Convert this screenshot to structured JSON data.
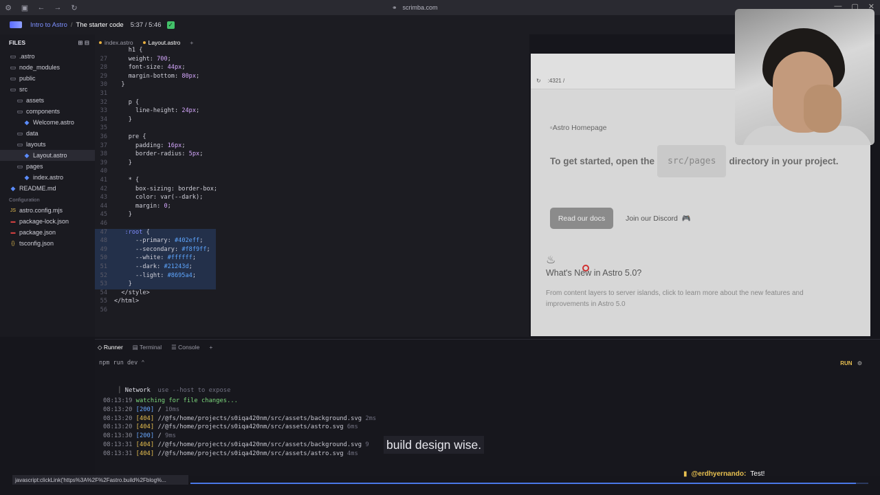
{
  "browser": {
    "url": "scrimba.com",
    "icons": [
      "app-icon",
      "sidebar-icon",
      "back-icon",
      "forward-icon",
      "reload-icon"
    ]
  },
  "header": {
    "course": "Intro to Astro",
    "separator": "/",
    "lesson": "The starter code",
    "time": "5:37 / 5:46",
    "check": "✓"
  },
  "sidebar": {
    "title": "FILES",
    "items": [
      {
        "label": ".astro",
        "type": "folder",
        "indent": 0
      },
      {
        "label": "node_modules",
        "type": "folder",
        "indent": 0
      },
      {
        "label": "public",
        "type": "folder",
        "indent": 0
      },
      {
        "label": "src",
        "type": "folder",
        "indent": 0
      },
      {
        "label": "assets",
        "type": "folder",
        "indent": 1
      },
      {
        "label": "components",
        "type": "folder",
        "indent": 1
      },
      {
        "label": "Welcome.astro",
        "type": "file",
        "indent": 2
      },
      {
        "label": "data",
        "type": "folder",
        "indent": 1
      },
      {
        "label": "layouts",
        "type": "folder",
        "indent": 1
      },
      {
        "label": "Layout.astro",
        "type": "file",
        "indent": 2,
        "active": true
      },
      {
        "label": "pages",
        "type": "folder",
        "indent": 1
      },
      {
        "label": "index.astro",
        "type": "file",
        "indent": 2
      },
      {
        "label": "README.md",
        "type": "file",
        "indent": 0
      }
    ],
    "config_label": "Configuration",
    "config_items": [
      {
        "label": "astro.config.mjs",
        "icon": "JS"
      },
      {
        "label": "package-lock.json",
        "icon": "pkg"
      },
      {
        "label": "package.json",
        "icon": "pkg"
      },
      {
        "label": "tsconfig.json",
        "icon": "{}"
      }
    ]
  },
  "editor": {
    "tabs": [
      {
        "label": "index.astro",
        "active": false
      },
      {
        "label": "Layout.astro",
        "active": true
      }
    ],
    "add_tab": "+",
    "lines": [
      {
        "n": "",
        "t": "    h1 {"
      },
      {
        "n": "27",
        "t": "    weight: 700;"
      },
      {
        "n": "28",
        "t": "    font-size: 44px;"
      },
      {
        "n": "29",
        "t": "    margin-bottom: 80px;"
      },
      {
        "n": "30",
        "t": "  }"
      },
      {
        "n": "31",
        "t": ""
      },
      {
        "n": "32",
        "t": "    p {"
      },
      {
        "n": "33",
        "t": "      line-height: 24px;"
      },
      {
        "n": "34",
        "t": "    }"
      },
      {
        "n": "35",
        "t": ""
      },
      {
        "n": "36",
        "t": "    pre {"
      },
      {
        "n": "37",
        "t": "      padding: 16px;"
      },
      {
        "n": "38",
        "t": "      border-radius: 5px;"
      },
      {
        "n": "39",
        "t": "    }"
      },
      {
        "n": "40",
        "t": ""
      },
      {
        "n": "41",
        "t": "    * {"
      },
      {
        "n": "42",
        "t": "      box-sizing: border-box;"
      },
      {
        "n": "43",
        "t": "      color: var(--dark);"
      },
      {
        "n": "44",
        "t": "      margin: 0;"
      },
      {
        "n": "45",
        "t": "    }"
      },
      {
        "n": "46",
        "t": ""
      },
      {
        "n": "47",
        "t": "   :root {",
        "hl": true
      },
      {
        "n": "48",
        "t": "      --primary: #402eff;",
        "hl": true
      },
      {
        "n": "49",
        "t": "      --secondary: #f8f9ff;",
        "hl": true
      },
      {
        "n": "50",
        "t": "      --white: #ffffff;",
        "hl": true
      },
      {
        "n": "51",
        "t": "      --dark: #21243d;",
        "hl": true
      },
      {
        "n": "52",
        "t": "      --light: #8695a4;",
        "hl": true
      },
      {
        "n": "53",
        "t": "    }",
        "hl": true
      },
      {
        "n": "54",
        "t": "  </style>"
      },
      {
        "n": "55",
        "t": "</html>"
      },
      {
        "n": "56",
        "t": ""
      }
    ]
  },
  "preview": {
    "address": ":4321 /",
    "broken_image": "Astro Homepage",
    "started_before": "To get started, open the",
    "started_code": "src/pages",
    "started_after": "directory in your project.",
    "docs_button": "Read our docs",
    "discord_link": "Join our Discord",
    "news_title": "What's New in Astro 5.0?",
    "news_desc": "From content layers to server islands, click to learn more about the new features and improvements in Astro 5.0"
  },
  "panel": {
    "tabs": [
      {
        "label": "Runner",
        "active": true
      },
      {
        "label": "Terminal",
        "active": false
      },
      {
        "label": "Console",
        "active": false
      }
    ],
    "add_tab": "+",
    "command": "npm run dev ⌃",
    "run_label": "RUN",
    "network_label": "Network",
    "network_hint": "use --host to expose",
    "log": [
      {
        "time": "08:13:19",
        "status": "",
        "kind": "watch",
        "path": "watching for file changes...",
        "ms": ""
      },
      {
        "time": "08:13:20",
        "status": "[200]",
        "kind": "ok",
        "path": "/",
        "ms": "10ms"
      },
      {
        "time": "08:13:20",
        "status": "[404]",
        "kind": "bad",
        "path": "//@fs/home/projects/s0iqa420nm/src/assets/background.svg",
        "ms": "2ms"
      },
      {
        "time": "08:13:20",
        "status": "[404]",
        "kind": "bad",
        "path": "//@fs/home/projects/s0iqa420nm/src/assets/astro.svg",
        "ms": "6ms"
      },
      {
        "time": "08:13:30",
        "status": "[200]",
        "kind": "ok",
        "path": "/",
        "ms": "9ms"
      },
      {
        "time": "08:13:31",
        "status": "[404]",
        "kind": "bad",
        "path": "//@fs/home/projects/s0iqa420nm/src/assets/background.svg",
        "ms": "9"
      },
      {
        "time": "08:13:31",
        "status": "[404]",
        "kind": "bad",
        "path": "//@fs/home/projects/s0iqa420nm/src/assets/astro.svg",
        "ms": "4ms"
      }
    ]
  },
  "subtitle": {
    "a": "build design",
    "b": "wise."
  },
  "chat": {
    "user": "@erdhyernando:",
    "message": "Test!"
  },
  "statusbar": "javascript:clickLink('https%3A%2F%2Fastro.build%2Fblog%...",
  "video_progress": 0.982,
  "colors": {
    "accent": "#4a78e8",
    "run": "#e8c050",
    "check": "#43c26a"
  }
}
